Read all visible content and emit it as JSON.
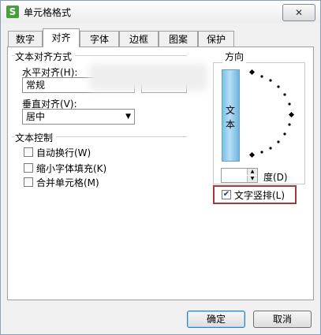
{
  "window": {
    "title": "单元格格式",
    "app_icon": "S",
    "close_symbol": "✕"
  },
  "tabs": [
    {
      "label": "数字",
      "active": false
    },
    {
      "label": "对齐",
      "active": true
    },
    {
      "label": "字体",
      "active": false
    },
    {
      "label": "边框",
      "active": false
    },
    {
      "label": "图案",
      "active": false
    },
    {
      "label": "保护",
      "active": false
    }
  ],
  "alignment": {
    "section_title": "文本对齐方式",
    "horizontal_label": "水平对齐(H):",
    "horizontal_value": "常规",
    "vertical_label": "垂直对齐(V):",
    "vertical_value": "居中"
  },
  "text_control": {
    "section_title": "文本控制",
    "options": [
      {
        "label": "自动换行(W)",
        "checked": false
      },
      {
        "label": "缩小字体填充(K)",
        "checked": false
      },
      {
        "label": "合并单元格(M)",
        "checked": false
      }
    ]
  },
  "orientation": {
    "title": "方向",
    "vertical_text": [
      "文",
      "本"
    ],
    "degree_value": "",
    "degree_label": "度(D)",
    "vertical_checkbox_label": "文字竖排(L)",
    "vertical_checked": true
  },
  "buttons": {
    "ok": "确定",
    "cancel": "取消"
  },
  "icons": {
    "checkmark": "✔",
    "dropdown_arrow": "▼",
    "spin_up": "▲",
    "spin_down": "▼"
  },
  "colors": {
    "highlight_border": "#a63a3a",
    "text_bar": "#7ac0ea",
    "app_icon": "#4a9d3f"
  }
}
